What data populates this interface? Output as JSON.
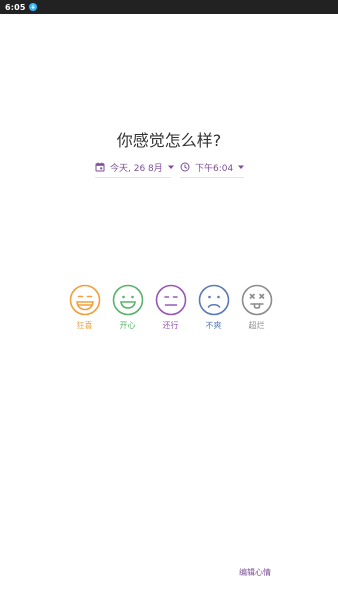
{
  "status_bar": {
    "time": "6:05"
  },
  "title": "你感觉怎么样?",
  "date_picker": {
    "label": "今天, 26 8月",
    "icon": "calendar-icon"
  },
  "time_picker": {
    "label": "下午6:04",
    "icon": "clock-icon"
  },
  "moods": [
    {
      "label": "狂喜",
      "icon": "grinning-face-icon",
      "color": "#f0a03c"
    },
    {
      "label": "开心",
      "icon": "smiling-face-icon",
      "color": "#58b36b"
    },
    {
      "label": "还行",
      "icon": "neutral-face-icon",
      "color": "#9a58b5"
    },
    {
      "label": "不爽",
      "icon": "sad-face-icon",
      "color": "#5c7ab5"
    },
    {
      "label": "超烂",
      "icon": "dead-face-icon",
      "color": "#8c8c8c"
    }
  ],
  "edit_moods_label": "编辑心情",
  "colors": {
    "accent": "#7d4e97",
    "status_bar": "#222222"
  }
}
